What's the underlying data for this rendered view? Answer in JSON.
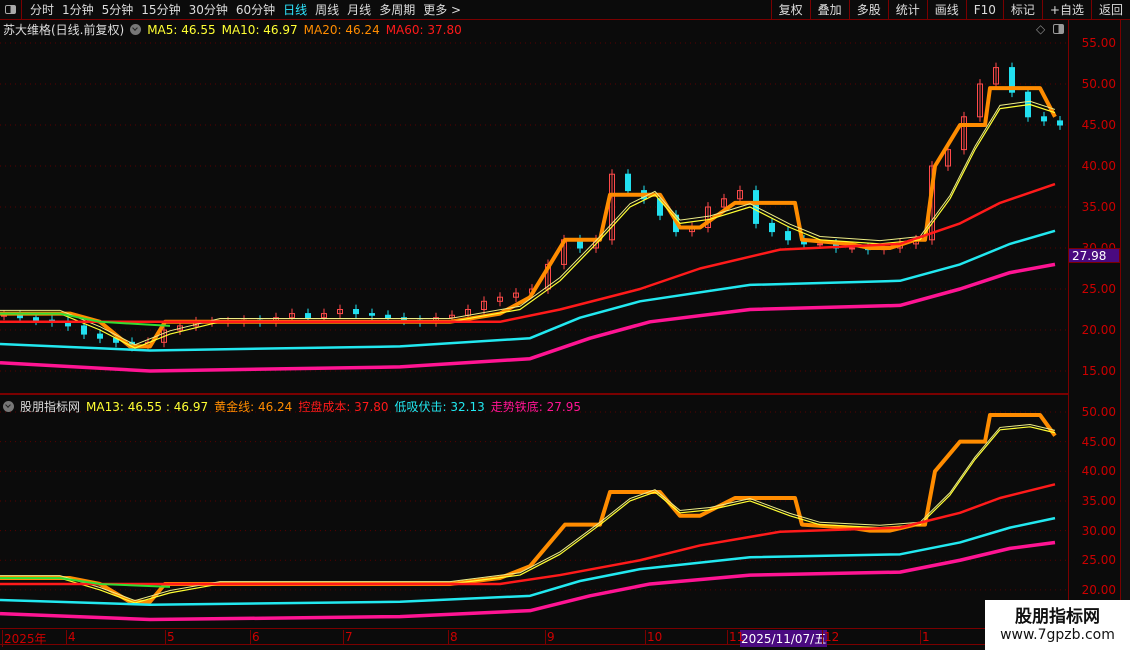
{
  "topbar": {
    "periods": [
      "分时",
      "1分钟",
      "5分钟",
      "15分钟",
      "30分钟",
      "60分钟",
      "日线",
      "周线",
      "月线",
      "多周期",
      "更多 >"
    ],
    "active": "日线",
    "tools": [
      "复权",
      "叠加",
      "多股",
      "统计",
      "画线",
      "F10",
      "标记",
      "+自选",
      "返回"
    ]
  },
  "main": {
    "title": "苏大维格(日线.前复权)",
    "ma5": "MA5: 46.55",
    "ma10": "MA10: 46.97",
    "ma20": "MA20: 46.24",
    "ma60": "MA60: 37.80",
    "yticks": [
      "55.00",
      "50.00",
      "45.00",
      "40.00",
      "35.00",
      "30.00",
      "25.00",
      "20.00",
      "15.00"
    ],
    "price_tag": "27.98"
  },
  "indicator": {
    "title": "股朋指标网",
    "ma13": "MA13: 46.55 : 46.97",
    "gold": "黄金线: 46.24",
    "cost": "控盘成本: 37.80",
    "low": "低吸伏击: 32.13",
    "bottom": "走势铁底: 27.95",
    "yticks": [
      "50.00",
      "45.00",
      "40.00",
      "35.00",
      "30.00",
      "25.00",
      "20.00"
    ]
  },
  "timeaxis": {
    "labels": [
      "2025年",
      "4",
      "5",
      "6",
      "7",
      "8",
      "9",
      "10",
      "11",
      "12",
      "1"
    ],
    "cursor_date": "2025/11/07/五"
  },
  "watermark": {
    "name": "股朋指标网",
    "url": "www.7gpzb.com"
  },
  "colors": {
    "up": "#ff4a4a",
    "down": "#22e0f0",
    "gold": "#ff8c00",
    "ma": "#ffff33",
    "cost": "#ff1a1a",
    "low": "#22e8f0",
    "bottom": "#ff1493",
    "green": "#33dd33"
  },
  "chart_data": {
    "type": "line",
    "x_unit": "bar index (4 bars per step)",
    "closes": [
      21.8,
      21.5,
      21.2,
      21,
      20.5,
      19.5,
      19,
      18.5,
      18,
      18.5,
      20,
      20.5,
      21,
      21,
      21,
      21.2,
      21,
      21.5,
      22,
      21.5,
      22,
      22.5,
      22,
      21.8,
      21.5,
      21.2,
      21,
      21.5,
      21.8,
      22.5,
      23.5,
      24,
      24.5,
      25,
      28,
      31,
      30,
      31,
      39,
      37,
      36,
      34,
      32,
      32.5,
      35,
      36,
      37,
      33,
      32,
      31,
      30.5,
      30.5,
      30,
      30,
      29.8,
      30,
      30.5,
      31,
      40,
      42,
      46,
      50,
      52,
      49,
      46,
      45.5,
      45
    ],
    "series": [
      {
        "name": "黄金线",
        "points": [
          [
            0,
            22
          ],
          [
            70,
            22
          ],
          [
            100,
            21
          ],
          [
            130,
            18
          ],
          [
            150,
            18
          ],
          [
            165,
            21
          ],
          [
            200,
            21
          ],
          [
            450,
            21
          ],
          [
            500,
            22
          ],
          [
            530,
            24
          ],
          [
            550,
            28
          ],
          [
            565,
            31
          ],
          [
            600,
            31
          ],
          [
            610,
            36.5
          ],
          [
            660,
            36.5
          ],
          [
            680,
            32.5
          ],
          [
            700,
            32.5
          ],
          [
            735,
            35.5
          ],
          [
            795,
            35.5
          ],
          [
            802,
            31
          ],
          [
            850,
            30.5
          ],
          [
            870,
            30
          ],
          [
            890,
            30
          ],
          [
            915,
            31
          ],
          [
            925,
            31
          ],
          [
            935,
            40
          ],
          [
            960,
            45
          ],
          [
            985,
            45
          ],
          [
            990,
            49.5
          ],
          [
            1040,
            49.5
          ],
          [
            1055,
            46
          ]
        ]
      },
      {
        "name": "MA",
        "points": [
          [
            0,
            22
          ],
          [
            60,
            22
          ],
          [
            100,
            20
          ],
          [
            135,
            17.8
          ],
          [
            170,
            19.5
          ],
          [
            220,
            21
          ],
          [
            450,
            21
          ],
          [
            520,
            22.5
          ],
          [
            560,
            26
          ],
          [
            600,
            31
          ],
          [
            630,
            35
          ],
          [
            655,
            36.5
          ],
          [
            680,
            33
          ],
          [
            710,
            33.5
          ],
          [
            750,
            35
          ],
          [
            790,
            32.5
          ],
          [
            820,
            31
          ],
          [
            880,
            30.5
          ],
          [
            920,
            31
          ],
          [
            950,
            36
          ],
          [
            975,
            42
          ],
          [
            1000,
            47
          ],
          [
            1030,
            47.5
          ],
          [
            1055,
            46.5
          ]
        ]
      },
      {
        "name": "控盘成本",
        "points": [
          [
            0,
            21
          ],
          [
            500,
            21
          ],
          [
            560,
            22.5
          ],
          [
            640,
            25
          ],
          [
            700,
            27.5
          ],
          [
            780,
            29.8
          ],
          [
            900,
            30.5
          ],
          [
            960,
            33
          ],
          [
            1000,
            35.5
          ],
          [
            1055,
            37.8
          ]
        ]
      },
      {
        "name": "低吸伏击",
        "points": [
          [
            0,
            18.3
          ],
          [
            150,
            17.5
          ],
          [
            400,
            18
          ],
          [
            530,
            19
          ],
          [
            580,
            21.5
          ],
          [
            640,
            23.5
          ],
          [
            750,
            25.5
          ],
          [
            900,
            26
          ],
          [
            960,
            28
          ],
          [
            1010,
            30.5
          ],
          [
            1055,
            32.1
          ]
        ]
      },
      {
        "name": "走势铁底",
        "points": [
          [
            0,
            16
          ],
          [
            150,
            15
          ],
          [
            400,
            15.5
          ],
          [
            530,
            16.5
          ],
          [
            590,
            19
          ],
          [
            650,
            21
          ],
          [
            750,
            22.5
          ],
          [
            900,
            23
          ],
          [
            960,
            25
          ],
          [
            1010,
            27
          ],
          [
            1055,
            28
          ]
        ]
      },
      {
        "name": "green",
        "points": [
          [
            0,
            22
          ],
          [
            60,
            22
          ],
          [
            100,
            21
          ],
          [
            170,
            20.5
          ]
        ]
      }
    ],
    "ylim_main": [
      15,
      55
    ],
    "ylim_indicator": [
      20,
      50
    ]
  }
}
